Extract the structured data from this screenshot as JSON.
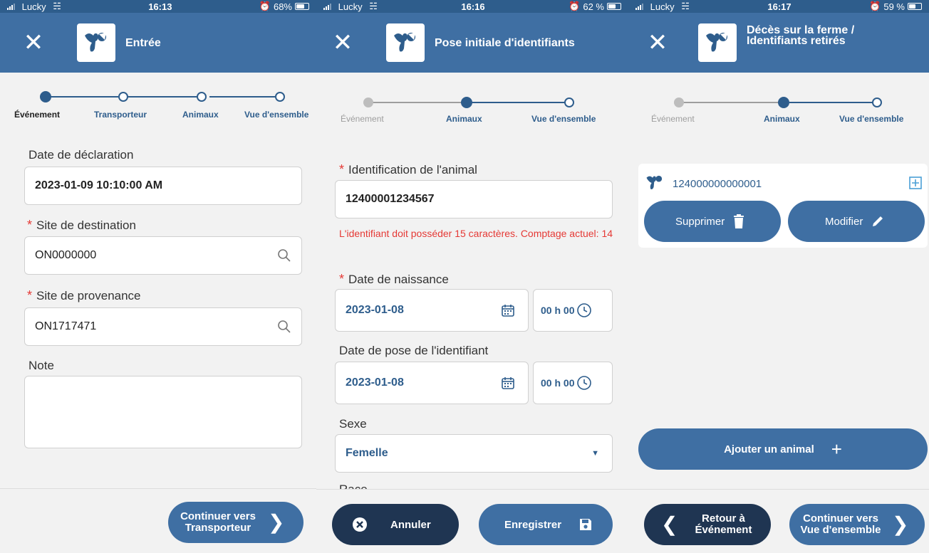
{
  "colors": {
    "header": "#3f6fa3",
    "accent": "#2e5d8c",
    "error": "#e53935",
    "dark_button": "#1f3552"
  },
  "screens": [
    {
      "status": {
        "carrier": "Lucky",
        "time": "16:13",
        "battery": "68%",
        "battery_level": 0.68
      },
      "header": {
        "title": "Entrée"
      },
      "steps": [
        "Événement",
        "Transporteur",
        "Animaux",
        "Vue d'ensemble"
      ],
      "fields": {
        "date_label": "Date de déclaration",
        "date_value": "2023-01-09 10:10:00 AM",
        "dest_label": "Site de destination",
        "dest_value": "ON0000000",
        "prov_label": "Site de provenance",
        "prov_value": "ON1717471",
        "note_label": "Note",
        "note_value": ""
      },
      "continue_label_1": "Continuer vers",
      "continue_label_2": "Transporteur"
    },
    {
      "status": {
        "carrier": "Lucky",
        "time": "16:16",
        "battery": "62 %",
        "battery_level": 0.62
      },
      "header": {
        "title": "Pose initiale d'identifiants"
      },
      "steps": [
        "Événement",
        "Animaux",
        "Vue d'ensemble"
      ],
      "fields": {
        "id_label": "Identification de l'animal",
        "id_value": "12400001234567",
        "id_error": "L'identifiant doit posséder 15 caractères. Comptage actuel: 14",
        "birth_label": "Date de naissance",
        "birth_date": "2023-01-08",
        "birth_time": "00 h 00",
        "tag_label": "Date de pose de l'identifiant",
        "tag_date": "2023-01-08",
        "tag_time": "00 h 00",
        "sex_label": "Sexe",
        "sex_value": "Femelle",
        "cut_label": "Race"
      },
      "cancel_label": "Annuler",
      "save_label": "Enregistrer"
    },
    {
      "status": {
        "carrier": "Lucky",
        "time": "16:17",
        "battery": "59 %",
        "battery_level": 0.59
      },
      "header": {
        "title_1": "Décès sur la ferme /",
        "title_2": "Identifiants retirés"
      },
      "steps": [
        "Événement",
        "Animaux",
        "Vue d'ensemble"
      ],
      "animal": {
        "id": "124000000000001",
        "delete_label": "Supprimer",
        "edit_label": "Modifier"
      },
      "add_label": "Ajouter un animal",
      "back_label_1": "Retour à",
      "back_label_2": "Événement",
      "continue_label_1": "Continuer vers",
      "continue_label_2": "Vue d'ensemble"
    }
  ]
}
